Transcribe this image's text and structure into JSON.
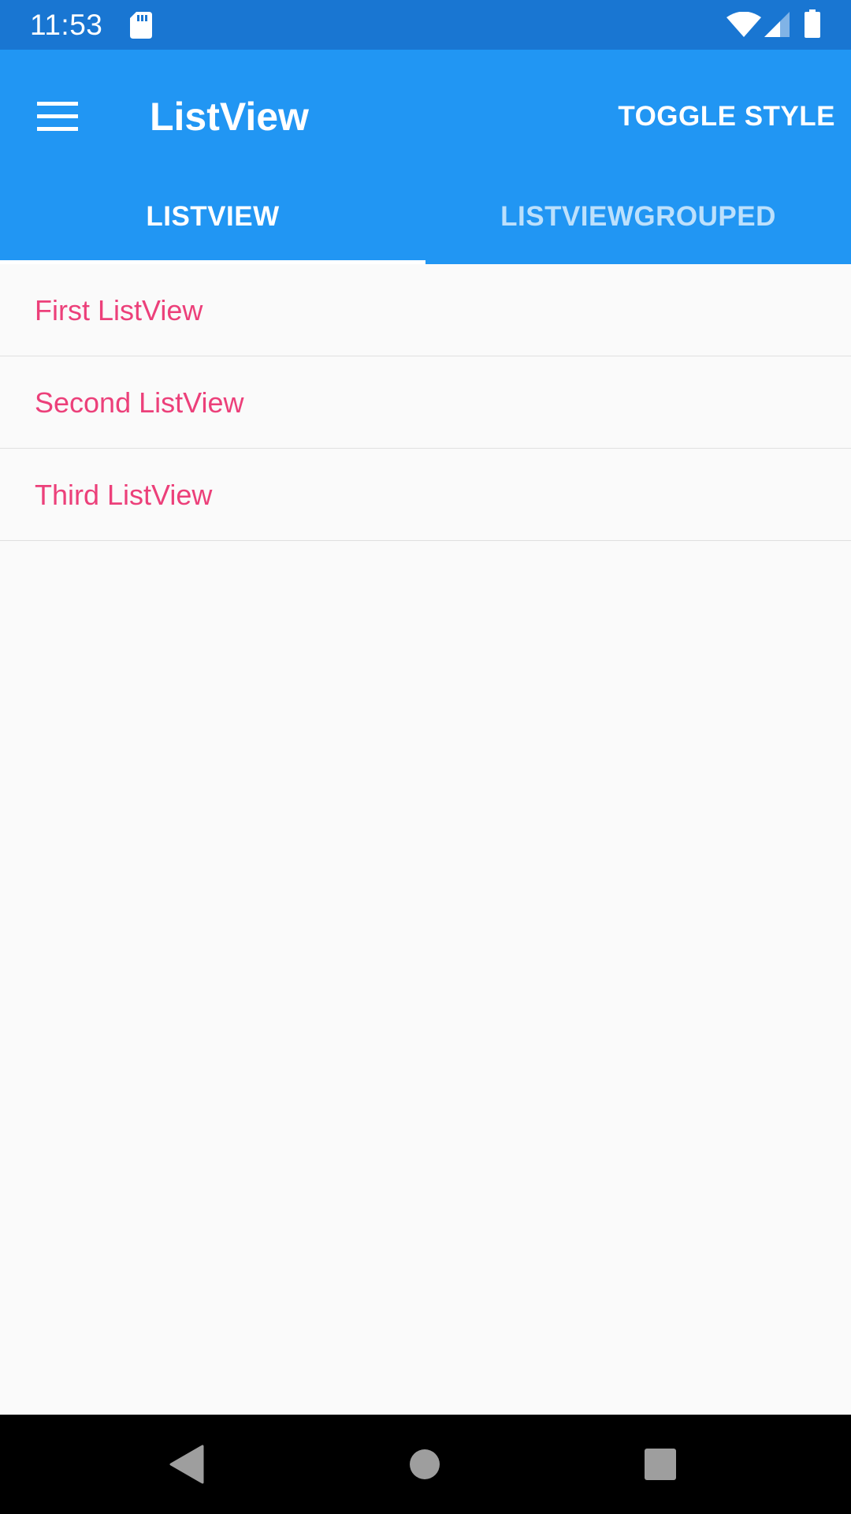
{
  "status_bar": {
    "time": "11:53",
    "icons": [
      "sd-card-icon",
      "wifi-icon",
      "cell-signal-icon",
      "battery-icon"
    ]
  },
  "app_bar": {
    "title": "ListView",
    "menu_icon": "hamburger-menu-icon",
    "toggle_style_label": "TOGGLE STYLE"
  },
  "tabs": [
    {
      "label": "LISTVIEW",
      "selected": true
    },
    {
      "label": "LISTVIEWGROUPED",
      "selected": false
    }
  ],
  "list": {
    "items": [
      {
        "label": "First ListView"
      },
      {
        "label": "Second ListView"
      },
      {
        "label": "Third ListView"
      }
    ]
  },
  "nav_bar": {
    "icons": [
      "back-icon",
      "home-icon",
      "recents-icon"
    ]
  },
  "colors": {
    "status_bar": "#1976D2",
    "app_bar": "#2196F3",
    "list_text": "#EC407A",
    "background": "#FAFAFA",
    "divider": "#E0E0E0",
    "nav_bar": "#000000"
  }
}
